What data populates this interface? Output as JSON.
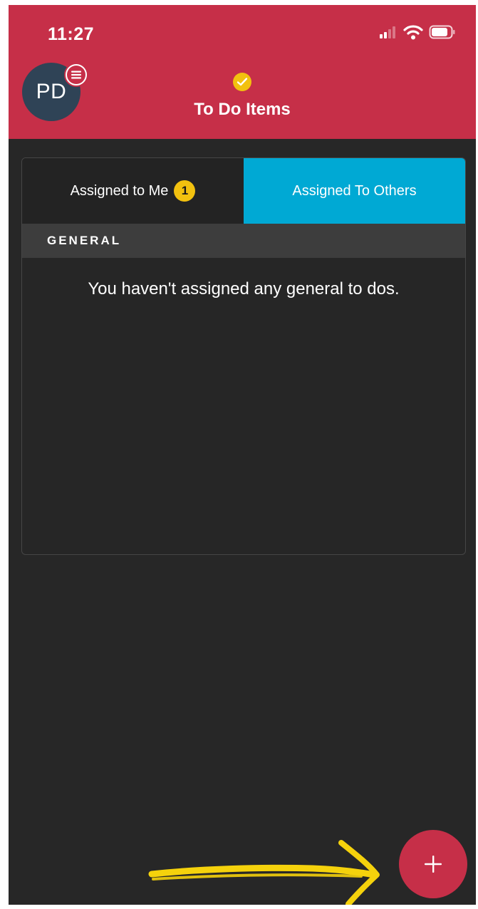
{
  "status_bar": {
    "time": "11:27",
    "signal_icon": "signal-bars-icon",
    "wifi_icon": "wifi-icon",
    "battery_icon": "battery-icon"
  },
  "header": {
    "avatar_initials": "PD",
    "menu_icon": "hamburger-menu-icon",
    "title_icon": "check-circle-icon",
    "title": "To Do Items"
  },
  "tabs": [
    {
      "label": "Assigned to Me",
      "badge": "1",
      "active": false
    },
    {
      "label": "Assigned To Others",
      "active": true
    }
  ],
  "section": {
    "title": "GENERAL",
    "empty_message": "You haven't assigned any general to dos."
  },
  "fab": {
    "icon": "plus-icon"
  },
  "annotation": {
    "icon": "hand-drawn-arrow-icon"
  },
  "colors": {
    "header_red": "#c62f48",
    "tab_active_blue": "#00a9d4",
    "badge_yellow": "#f2c10f",
    "background_dark": "#272727",
    "avatar_navy": "#2f4356",
    "arrow_yellow": "#f5d20c"
  }
}
